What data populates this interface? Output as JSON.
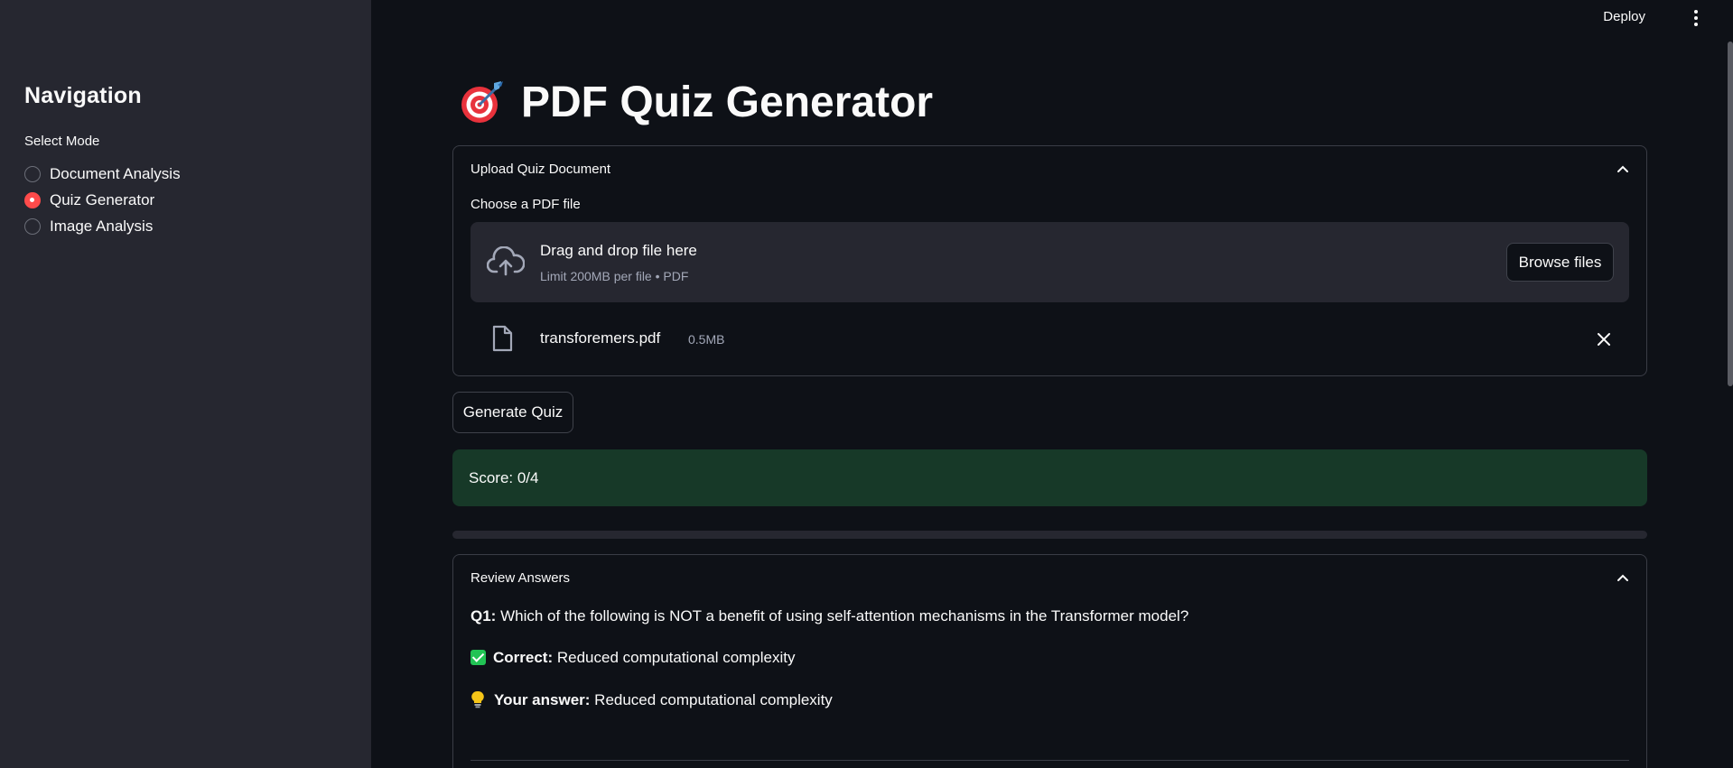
{
  "header": {
    "deploy_label": "Deploy",
    "menu_icon": "kebab-menu-icon"
  },
  "sidebar": {
    "title": "Navigation",
    "select_label": "Select Mode",
    "options": [
      {
        "label": "Document Analysis",
        "checked": false
      },
      {
        "label": "Quiz Generator",
        "checked": true
      },
      {
        "label": "Image Analysis",
        "checked": false
      }
    ]
  },
  "main": {
    "title_icon": "target-icon",
    "title": "PDF Quiz Generator",
    "upload": {
      "header": "Upload Quiz Document",
      "file_label": "Choose a PDF file",
      "drop_title": "Drag and drop file here",
      "drop_limit": "Limit 200MB per file • PDF",
      "browse_label": "Browse files",
      "file_name": "transforemers.pdf",
      "file_size": "0.5MB"
    },
    "generate_label": "Generate Quiz",
    "score_text": "Score: 0/4",
    "progress_fraction": 0,
    "review": {
      "header": "Review Answers",
      "q_prefix": "Q1:",
      "q_text": " Which of the following is NOT a benefit of using self-attention mechanisms in the Transformer model?",
      "correct_label": "Correct:",
      "correct_text": " Reduced computational complexity",
      "your_label": "Your answer:",
      "your_text": " Reduced computational complexity"
    }
  },
  "colors": {
    "accent": "#ff4b4b",
    "success_bg": "#173928",
    "check": "#21c354",
    "sidebar_bg": "#262730",
    "page_bg": "#0e1117"
  }
}
